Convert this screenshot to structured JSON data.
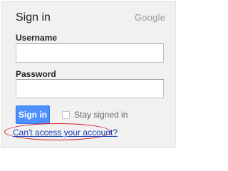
{
  "form": {
    "title": "Sign in",
    "brand": "Google",
    "username_label": "Username",
    "username_value": "",
    "password_label": "Password",
    "password_value": "",
    "signin_label": "Sign in",
    "stay_signed_in_label": "Stay signed in",
    "stay_signed_in_checked": false,
    "help_link": "Can't access your account?"
  },
  "colors": {
    "panel_background": "#f1f1f1",
    "button_blue": "#4d90fe",
    "link_blue": "#1b3fb5",
    "highlight_oval": "#d0202a"
  }
}
